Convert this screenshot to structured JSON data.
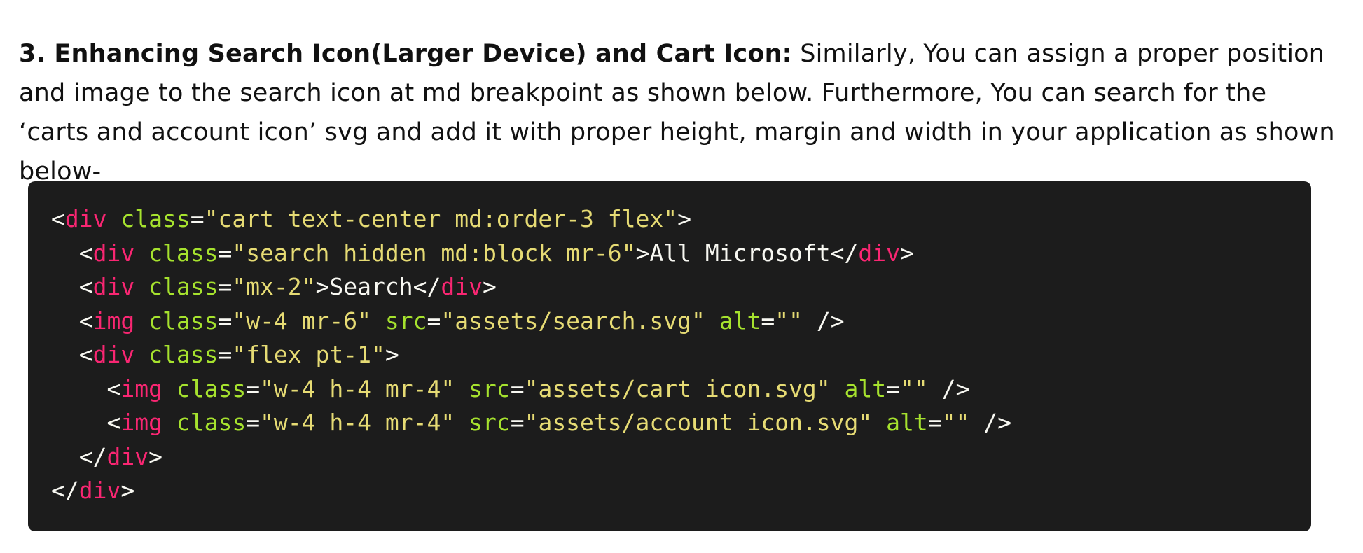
{
  "paragraph": {
    "lead": "3. Enhancing Search Icon(Larger Device) and Cart Icon:",
    "body": " Similarly, You can assign a proper position and image to the search icon at md breakpoint as shown below. Furthermore, You can search for the ‘carts and account icon’ svg and add it with proper height, margin and width in your application as shown below-"
  },
  "code": {
    "language": "html",
    "colors": {
      "background": "#1c1c1c",
      "punctuation": "#f8f8f2",
      "tag": "#f92672",
      "attribute": "#a6e22e",
      "string": "#e6db74",
      "text": "#f8f8f2"
    },
    "lines": [
      {
        "indent": "",
        "tokens": [
          [
            "punct",
            "<"
          ],
          [
            "tag",
            "div"
          ],
          [
            "punct",
            " "
          ],
          [
            "attr",
            "class"
          ],
          [
            "punct",
            "="
          ],
          [
            "str",
            "\"cart text-center md:order-3 flex\""
          ],
          [
            "punct",
            ">"
          ]
        ]
      },
      {
        "indent": "  ",
        "tokens": [
          [
            "punct",
            "<"
          ],
          [
            "tag",
            "div"
          ],
          [
            "punct",
            " "
          ],
          [
            "attr",
            "class"
          ],
          [
            "punct",
            "="
          ],
          [
            "str",
            "\"search hidden md:block mr-6\""
          ],
          [
            "punct",
            ">"
          ],
          [
            "text",
            "All Microsoft"
          ],
          [
            "punct",
            "</"
          ],
          [
            "tag",
            "div"
          ],
          [
            "punct",
            ">"
          ]
        ]
      },
      {
        "indent": "  ",
        "tokens": [
          [
            "punct",
            "<"
          ],
          [
            "tag",
            "div"
          ],
          [
            "punct",
            " "
          ],
          [
            "attr",
            "class"
          ],
          [
            "punct",
            "="
          ],
          [
            "str",
            "\"mx-2\""
          ],
          [
            "punct",
            ">"
          ],
          [
            "text",
            "Search"
          ],
          [
            "punct",
            "</"
          ],
          [
            "tag",
            "div"
          ],
          [
            "punct",
            ">"
          ]
        ]
      },
      {
        "indent": "  ",
        "tokens": [
          [
            "punct",
            "<"
          ],
          [
            "tag",
            "img"
          ],
          [
            "punct",
            " "
          ],
          [
            "attr",
            "class"
          ],
          [
            "punct",
            "="
          ],
          [
            "str",
            "\"w-4 mr-6\""
          ],
          [
            "punct",
            " "
          ],
          [
            "attr",
            "src"
          ],
          [
            "punct",
            "="
          ],
          [
            "str",
            "\"assets/search.svg\""
          ],
          [
            "punct",
            " "
          ],
          [
            "attr",
            "alt"
          ],
          [
            "punct",
            "="
          ],
          [
            "str",
            "\"\""
          ],
          [
            "punct",
            " />"
          ]
        ]
      },
      {
        "indent": "  ",
        "tokens": [
          [
            "punct",
            "<"
          ],
          [
            "tag",
            "div"
          ],
          [
            "punct",
            " "
          ],
          [
            "attr",
            "class"
          ],
          [
            "punct",
            "="
          ],
          [
            "str",
            "\"flex pt-1\""
          ],
          [
            "punct",
            ">"
          ]
        ]
      },
      {
        "indent": "    ",
        "tokens": [
          [
            "punct",
            "<"
          ],
          [
            "tag",
            "img"
          ],
          [
            "punct",
            " "
          ],
          [
            "attr",
            "class"
          ],
          [
            "punct",
            "="
          ],
          [
            "str",
            "\"w-4 h-4 mr-4\""
          ],
          [
            "punct",
            " "
          ],
          [
            "attr",
            "src"
          ],
          [
            "punct",
            "="
          ],
          [
            "str",
            "\"assets/cart icon.svg\""
          ],
          [
            "punct",
            " "
          ],
          [
            "attr",
            "alt"
          ],
          [
            "punct",
            "="
          ],
          [
            "str",
            "\"\""
          ],
          [
            "punct",
            " />"
          ]
        ]
      },
      {
        "indent": "    ",
        "tokens": [
          [
            "punct",
            "<"
          ],
          [
            "tag",
            "img"
          ],
          [
            "punct",
            " "
          ],
          [
            "attr",
            "class"
          ],
          [
            "punct",
            "="
          ],
          [
            "str",
            "\"w-4 h-4 mr-4\""
          ],
          [
            "punct",
            " "
          ],
          [
            "attr",
            "src"
          ],
          [
            "punct",
            "="
          ],
          [
            "str",
            "\"assets/account icon.svg\""
          ],
          [
            "punct",
            " "
          ],
          [
            "attr",
            "alt"
          ],
          [
            "punct",
            "="
          ],
          [
            "str",
            "\"\""
          ],
          [
            "punct",
            " />"
          ]
        ]
      },
      {
        "indent": "  ",
        "tokens": [
          [
            "punct",
            "</"
          ],
          [
            "tag",
            "div"
          ],
          [
            "punct",
            ">"
          ]
        ]
      },
      {
        "indent": "",
        "tokens": [
          [
            "punct",
            "</"
          ],
          [
            "tag",
            "div"
          ],
          [
            "punct",
            ">"
          ]
        ]
      }
    ]
  }
}
